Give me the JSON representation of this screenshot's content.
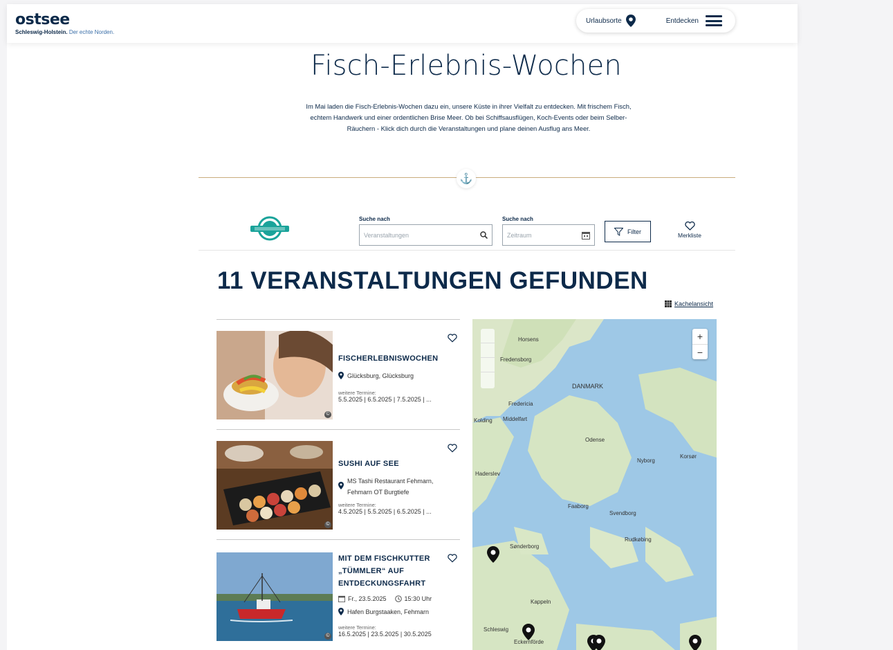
{
  "header": {
    "logo_main": "ostsee",
    "logo_sub_bold": "Schleswig-Holstein.",
    "logo_sub_rest": "Der echte Norden.",
    "nav_holiday": "Urlaubsorte",
    "nav_explore": "Entdecken",
    "icons": [
      "map-pin-icon",
      "menu-icon"
    ]
  },
  "hero": {
    "title": "Fisch-Erlebnis-Wochen",
    "intro_line1": "Im Mai laden die Fisch-Erlebnis-Wochen dazu ein, unsere Küste in ihrer Vielfalt zu entdecken. Mit frischem Fisch,",
    "intro_line2": "echtem Handwerk und einer ordentlichen Brise Meer. Ob bei Schiffsausflügen, Koch-Events oder beim Selber-",
    "intro_line3": "Räuchern -  Klick dich durch die Veranstaltungen und plane deinen Ausflug ans Meer."
  },
  "filters": {
    "search_label": "Suche nach",
    "search_placeholder": "Veranstaltungen",
    "date_label": "Suche nach",
    "date_placeholder": "Zeitraum",
    "filter_button": "Filter",
    "watchlist": "Merkliste"
  },
  "results": {
    "title": "11 VERANSTALTUNGEN GEFUNDEN",
    "view_toggle": "Kachelansicht"
  },
  "events": [
    {
      "title": "FISCHERLEBNISWOCHEN",
      "location": "Glücksburg, Glücksburg",
      "more_label": "weitere Termine:",
      "more_dates": "5.5.2025 | 6.5.2025 | 7.5.2025 | ..."
    },
    {
      "title": "SUSHI AUF SEE",
      "location": "MS Tashi Restaurant Fehmarn, Fehmarn OT Burgtiefe",
      "more_label": "weitere Termine:",
      "more_dates": "4.5.2025 | 5.5.2025 | 6.5.2025 | ..."
    },
    {
      "title": "MIT DEM FISCHKUTTER „TÜMMLER“ AUF ENTDECKUNGSFAHRT",
      "date": "Fr., 23.5.2025",
      "time": "15:30 Uhr",
      "location": "Hafen Burgstaaken, Fehmarn",
      "more_label": "weitere Termine:",
      "more_dates": "16.5.2025 | 23.5.2025 | 30.5.2025"
    }
  ],
  "map": {
    "labels": [
      "Horsens",
      "Fredericia",
      "DANMARK",
      "Kolding",
      "Middelfart",
      "Odense",
      "Haderslev",
      "Nyborg",
      "Faaborg",
      "Svendborg",
      "Sønderborg",
      "Rudkøbing",
      "Kappeln",
      "Schleswig",
      "Eckernförde",
      "Fredensborg",
      "Korsør"
    ],
    "zoom_in": "+",
    "zoom_out": "−"
  }
}
